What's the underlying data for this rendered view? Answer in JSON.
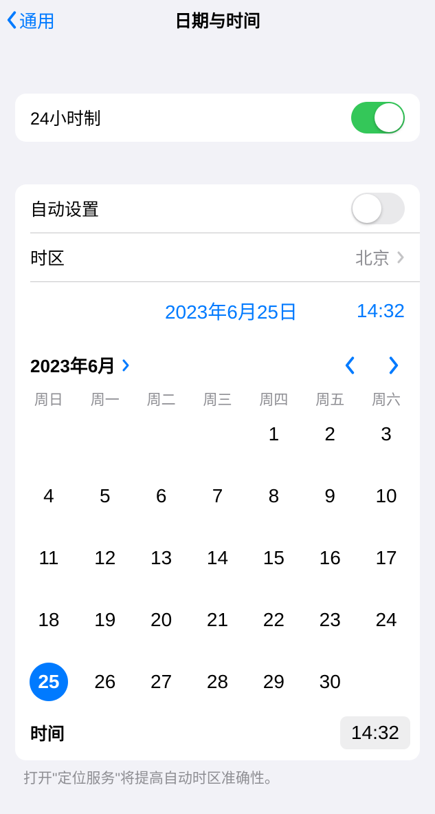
{
  "nav": {
    "back": "通用",
    "title": "日期与时间"
  },
  "s24h": {
    "label": "24小时制",
    "on": true
  },
  "auto": {
    "label": "自动设置",
    "on": false
  },
  "timezone": {
    "label": "时区",
    "value": "北京"
  },
  "current": {
    "date": "2023年6月25日",
    "time": "14:32"
  },
  "calendar": {
    "monthTitle": "2023年6月",
    "weekdays": [
      "周日",
      "周一",
      "周二",
      "周三",
      "周四",
      "周五",
      "周六"
    ],
    "startOffset": 4,
    "daysInMonth": 30,
    "selected": 25
  },
  "timeRow": {
    "label": "时间",
    "value": "14:32"
  },
  "footnote": "打开\"定位服务\"将提高自动时区准确性。"
}
